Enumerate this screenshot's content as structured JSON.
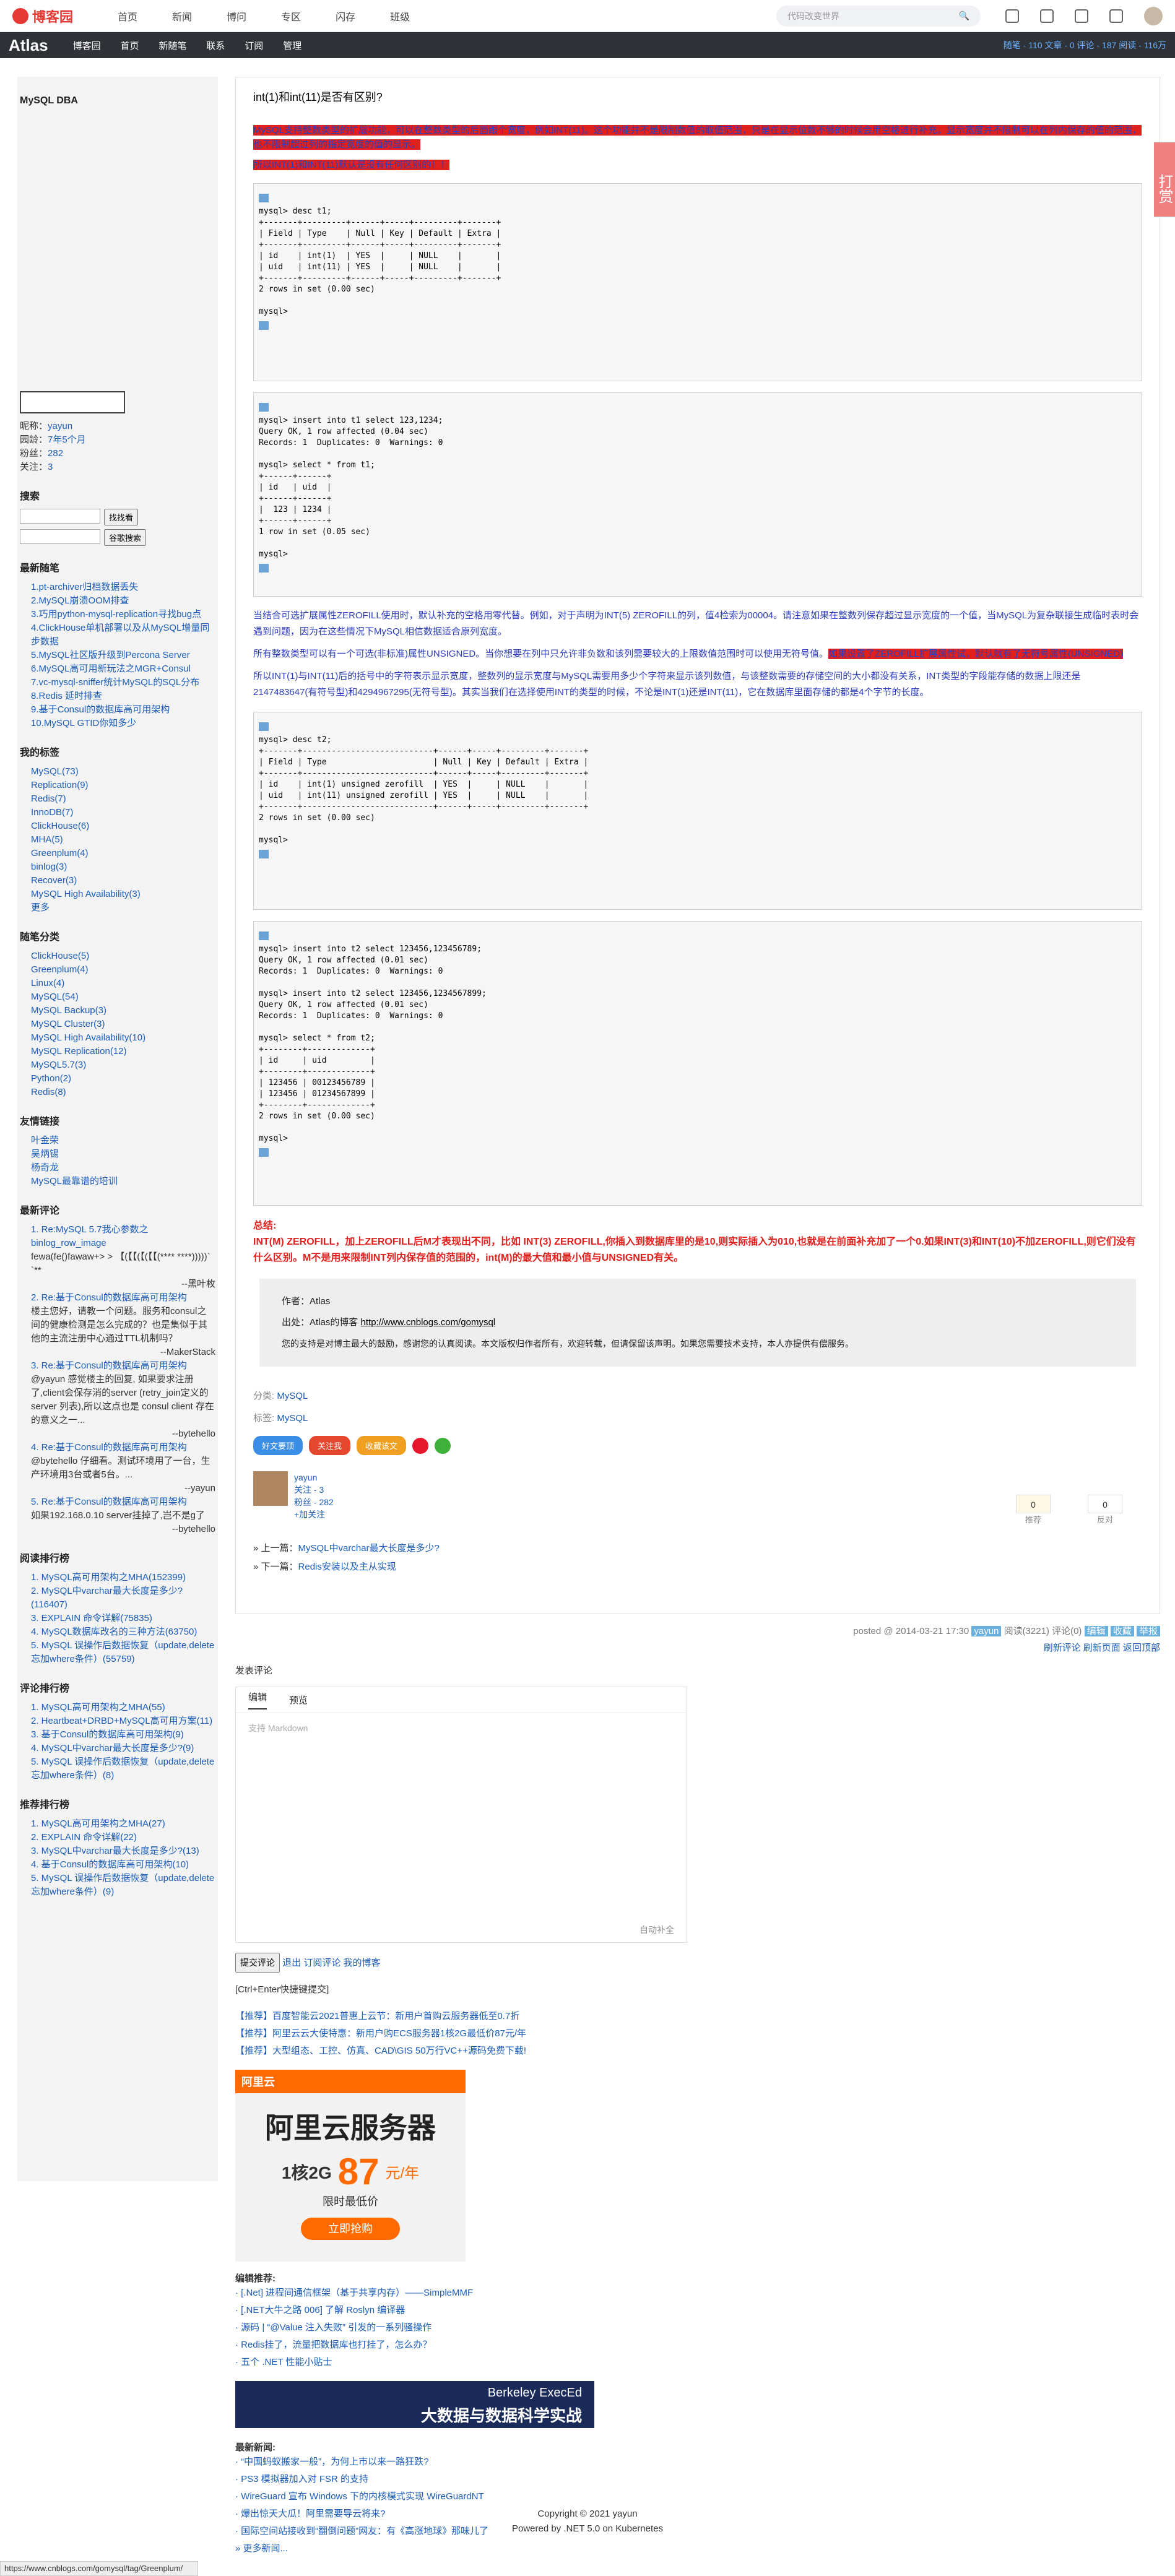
{
  "topnav": {
    "logo": "博客园",
    "links": [
      "首页",
      "新闻",
      "博问",
      "专区",
      "闪存",
      "班级"
    ],
    "search_placeholder": "代码改变世界"
  },
  "blog": {
    "title": "Atlas",
    "menu": [
      "博客园",
      "首页",
      "新随笔",
      "联系",
      "订阅",
      "管理"
    ],
    "stats": "随笔 - 110  文章 - 0  评论 - 187  阅读 - 116万"
  },
  "sidebar": {
    "subtitle": "MySQL DBA",
    "profile": {
      "nick_label": "昵称：",
      "nick": "yayun",
      "age_label": "园龄：",
      "age": "7年5个月",
      "fans_label": "粉丝：",
      "fans": "282",
      "follow_label": "关注：",
      "follow": "3"
    },
    "search_title": "搜索",
    "search_btn": "找找看",
    "google_btn": "谷歌搜索",
    "latest_title": "最新随笔",
    "latest": [
      "1.pt-archiver归档数据丢失",
      "2.MySQL崩溃OOM排查",
      "3.巧用python-mysql-replication寻找bug点",
      "4.ClickHouse单机部署以及从MySQL增量同步数据",
      "5.MySQL社区版升级到Percona Server",
      "6.MySQL高可用新玩法之MGR+Consul",
      "7.vc-mysql-sniffer统计MySQL的SQL分布",
      "8.Redis 延时排查",
      "9.基于Consul的数据库高可用架构",
      "10.MySQL GTID你知多少"
    ],
    "tags_title": "我的标签",
    "tags": [
      "MySQL(73)",
      "Replication(9)",
      "Redis(7)",
      "InnoDB(7)",
      "ClickHouse(6)",
      "MHA(5)",
      "Greenplum(4)",
      "binlog(3)",
      "Recover(3)",
      "MySQL High Availability(3)",
      "更多"
    ],
    "cats_title": "随笔分类",
    "cats": [
      "ClickHouse(5)",
      "Greenplum(4)",
      "Linux(4)",
      "MySQL(54)",
      "MySQL Backup(3)",
      "MySQL Cluster(3)",
      "MySQL High Availability(10)",
      "MySQL Replication(12)",
      "MySQL5.7(3)",
      "Python(2)",
      "Redis(8)"
    ],
    "links_title": "友情链接",
    "links": [
      "叶金荣",
      "吴炳锡",
      "杨奇龙",
      "MySQL最靠谱的培训"
    ],
    "comments_title": "最新评论",
    "comments": [
      {
        "title": "1. Re:MySQL 5.7我心参数之binlog_row_image",
        "body": "fewa(fe()fawaw+> > 【(【【(【(【【(**** ****)))))` `**",
        "author": "--黑叶枚"
      },
      {
        "title": "2. Re:基于Consul的数据库高可用架构",
        "body": "楼主您好，请教一个问题。服务和consul之间的健康检测是怎么完成的？也是集似于其他的主流注册中心通过TTL机制吗？",
        "author": "--MakerStack"
      },
      {
        "title": "3. Re:基于Consul的数据库高可用架构",
        "body": "@yayun 感觉楼主的回复, 如果要求注册了,client会保存消的server (retry_join定义的 server 列表),所以这点也是 consul client 存在的意义之一...",
        "author": "--bytehello"
      },
      {
        "title": "4. Re:基于Consul的数据库高可用架构",
        "body": "@bytehello 仔细看。测试环境用了一台，生产环境用3台或者5台。...",
        "author": "--yayun"
      },
      {
        "title": "5. Re:基于Consul的数据库高可用架构",
        "body": "如果192.168.0.10 server挂掉了,岂不是g了",
        "author": "--bytehello"
      }
    ],
    "read_title": "阅读排行榜",
    "read": [
      "1. MySQL高可用架构之MHA(152399)",
      "2. MySQL中varchar最大长度是多少?(116407)",
      "3. EXPLAIN 命令详解(75835)",
      "4. MySQL数据库改名的三种方法(63750)",
      "5. MySQL 误操作后数据恢复（update,delete忘加where条件）(55759)"
    ],
    "cmt_rank_title": "评论排行榜",
    "cmt_rank": [
      "1. MySQL高可用架构之MHA(55)",
      "2. Heartbeat+DRBD+MySQL高可用方案(11)",
      "3. 基于Consul的数据库高可用架构(9)",
      "4. MySQL中varchar最大长度是多少?(9)",
      "5. MySQL 误操作后数据恢复（update,delete忘加where条件）(8)"
    ],
    "rec_rank_title": "推荐排行榜",
    "rec_rank": [
      "1. MySQL高可用架构之MHA(27)",
      "2. EXPLAIN 命令详解(22)",
      "3. MySQL中varchar最大长度是多少?(13)",
      "4. 基于Consul的数据库高可用架构(10)",
      "5. MySQL 误操作后数据恢复（update,delete忘加where条件）(9)"
    ]
  },
  "post": {
    "title": "int(1)和int(11)是否有区别?",
    "p1": "MySQL支持整数类型的扩展功能，可以在整数类型的后面跟个宽度，例如INT(11)。这个功能并不是限制数值的取值范围，只是在显示位数不够的时候会用空格进行补充。显示宽度并不限制可以在列内保存的值的范围，也不限制超过列的指定宽度的值的显示。",
    "p2": "所以INT(1)和INT(11)默认是没有任何区别的！！",
    "code1": "mysql> desc t1;\n+-------+---------+------+-----+---------+-------+\n| Field | Type    | Null | Key | Default | Extra |\n+-------+---------+------+-----+---------+-------+\n| id    | int(1)  | YES  |     | NULL    |       |\n| uid   | int(11) | YES  |     | NULL    |       |\n+-------+---------+------+-----+---------+-------+\n2 rows in set (0.00 sec)\n\nmysql>",
    "code2": "mysql> insert into t1 select 123,1234;\nQuery OK, 1 row affected (0.04 sec)\nRecords: 1  Duplicates: 0  Warnings: 0\n\nmysql> select * from t1;\n+------+------+\n| id   | uid  |\n+------+------+\n|  123 | 1234 |\n+------+------+\n1 row in set (0.05 sec)\n\nmysql>",
    "p3": "当结合可选扩展属性ZEROFILL使用时，默认补充的空格用零代替。例如，对于声明为INT(5) ZEROFILL的列，值4检索为00004。请注意如果在整数列保存超过显示宽度的一个值，当MySQL为复杂联接生成临时表时会遇到问题，因为在这些情况下MySQL相信数据适合原列宽度。",
    "p4a": "所有整数类型可以有一个可选(非标准)属性UNSIGNED。当你想要在列中只允许非负数和该列需要较大的上限数值范围时可以使用无符号值。",
    "p4b": "如果设置了ZEROFILL扩展属性试，默认就有了无符号属性(UNSIGNED)",
    "p5": "所以INT(1)与INT(11)后的括号中的字符表示显示宽度，整数列的显示宽度与MySQL需要用多少个字符来显示该列数值，与该整数需要的存储空间的大小都没有关系，INT类型的字段能存储的数据上限还是2147483647(有符号型)和4294967295(无符号型)。其实当我们在选择使用INT的类型的时候，不论是INT(1)还是INT(11)，它在数据库里面存储的都是4个字节的长度。",
    "code3": "mysql> desc t2;\n+-------+---------------------------+------+-----+---------+-------+\n| Field | Type                      | Null | Key | Default | Extra |\n+-------+---------------------------+------+-----+---------+-------+\n| id    | int(1) unsigned zerofill  | YES  |     | NULL    |       |\n| uid   | int(11) unsigned zerofill | YES  |     | NULL    |       |\n+-------+---------------------------+------+-----+---------+-------+\n2 rows in set (0.00 sec)\n\nmysql>",
    "code4": "mysql> insert into t2 select 123456,123456789;\nQuery OK, 1 row affected (0.01 sec)\nRecords: 1  Duplicates: 0  Warnings: 0\n\nmysql> insert into t2 select 123456,1234567899;\nQuery OK, 1 row affected (0.01 sec)\nRecords: 1  Duplicates: 0  Warnings: 0\n\nmysql> select * from t2;\n+--------+-------------+\n| id     | uid         |\n+--------+-------------+\n| 123456 | 00123456789 |\n| 123456 | 01234567899 |\n+--------+-------------+\n2 rows in set (0.00 sec)\n\nmysql>",
    "summary_label": "总结:",
    "summary": "INT(M) ZEROFILL，加上ZEROFILL后M才表现出不同，比如 INT(3) ZEROFILL,你插入到数据库里的是10,则实际插入为010,也就是在前面补充加了一个0.如果INT(3)和INT(10)不加ZEROFILL,则它们没有什么区别。M不是用来限制INT列内保存值的范围的，int(M)的最大值和最小值与UNSIGNED有关。",
    "author_label": "作者：",
    "author": "Atlas",
    "source_label": "出处：",
    "source_pre": "Atlas的博客 ",
    "source_url": "http://www.cnblogs.com/gomysql",
    "support_text": "您的支持是对博主最大的鼓励，感谢您的认真阅读。本文版权归作者所有，欢迎转载，但请保留该声明。如果您需要技术支持，本人亦提供有偿服务。",
    "category_label": "分类:",
    "category": "MySQL",
    "tag_label": "标签:",
    "tag": "MySQL",
    "share": [
      "好文要顶",
      "关注我",
      "收藏该文"
    ],
    "follow_name": "yayun",
    "follow_line1": "关注 - 3",
    "follow_line2": "粉丝 - 282",
    "follow_btn": "+加关注",
    "digg_num": "0",
    "bury_num": "0",
    "digg_label": "推荐",
    "bury_label": "反对",
    "prev_label": "» 上一篇：",
    "prev": "MySQL中varchar最大长度是多少?",
    "next_label": "» 下一篇：",
    "next": "Redis安装以及主从实现",
    "footer_meta": "posted @ 2014-03-21 17:30",
    "footer_author": "yayun",
    "footer_read": "阅读(3221)  评论(0)",
    "footer_edit": "编辑",
    "footer_fav": "收藏",
    "footer_report": "举报",
    "links_right": [
      "刷新评论",
      "刷新页面",
      "返回顶部"
    ]
  },
  "comment": {
    "label": "发表评论",
    "tabs": [
      "编辑",
      "预览"
    ],
    "placeholder": "支持 Markdown",
    "autosave": "自动补全",
    "submit": "提交评论",
    "exit": "退出",
    "subscribe": "订阅评论",
    "mine": "我的博客",
    "hint": "[Ctrl+Enter快捷键提交]"
  },
  "ads": [
    "【推荐】百度智能云2021普惠上云节：新用户首购云服务器低至0.7折",
    "【推荐】阿里云云大使特惠：新用户购ECS服务器1核2G最低价87元/年",
    "【推荐】大型组态、工控、仿真、CAD\\GIS 50万行VC++源码免费下载!"
  ],
  "aliyun": {
    "brand": "阿里云",
    "title": "阿里云服务器",
    "spec": "1核2G",
    "price_label": "限时最低价",
    "price": "87",
    "unit": "元/年",
    "btn": "立即抢购"
  },
  "editor_rec": {
    "title": "编辑推荐:",
    "items": [
      "· [.Net] 进程间通信框架（基于共享内存）——SimpleMMF",
      "· [.NET大牛之路 006] 了解 Roslyn 编译器",
      "· 源码 | “@Value 注入失败” 引发的一系列骚操作",
      "· Redis挂了，流量把数据库也打挂了，怎么办？",
      "· 五个 .NET 性能小贴士"
    ]
  },
  "berkeley": {
    "brand": "Berkeley ExecEd",
    "title": "大数据与数据科学实战"
  },
  "news": {
    "title": "最新新闻:",
    "items": [
      "· “中国蚂蚁搬家一般”，为何上市以来一路狂跌?",
      "· PS3 模拟器加入对 FSR 的支持",
      "· WireGuard 宣布 Windows 下的内核模式实现 WireGuardNT",
      "· 爆出惊天大瓜！阿里需要导云将来?",
      "· 国际空间站接收到“翻倒问题”网友：有《高涨地球》那味儿了",
      "» 更多新闻..."
    ]
  },
  "footer": {
    "copyright": "Copyright © 2021 yayun",
    "powered": "Powered by .NET 5.0 on Kubernetes"
  },
  "status_url": "https://www.cnblogs.com/gomysql/tag/Greenplum/",
  "dashang": "打赏"
}
